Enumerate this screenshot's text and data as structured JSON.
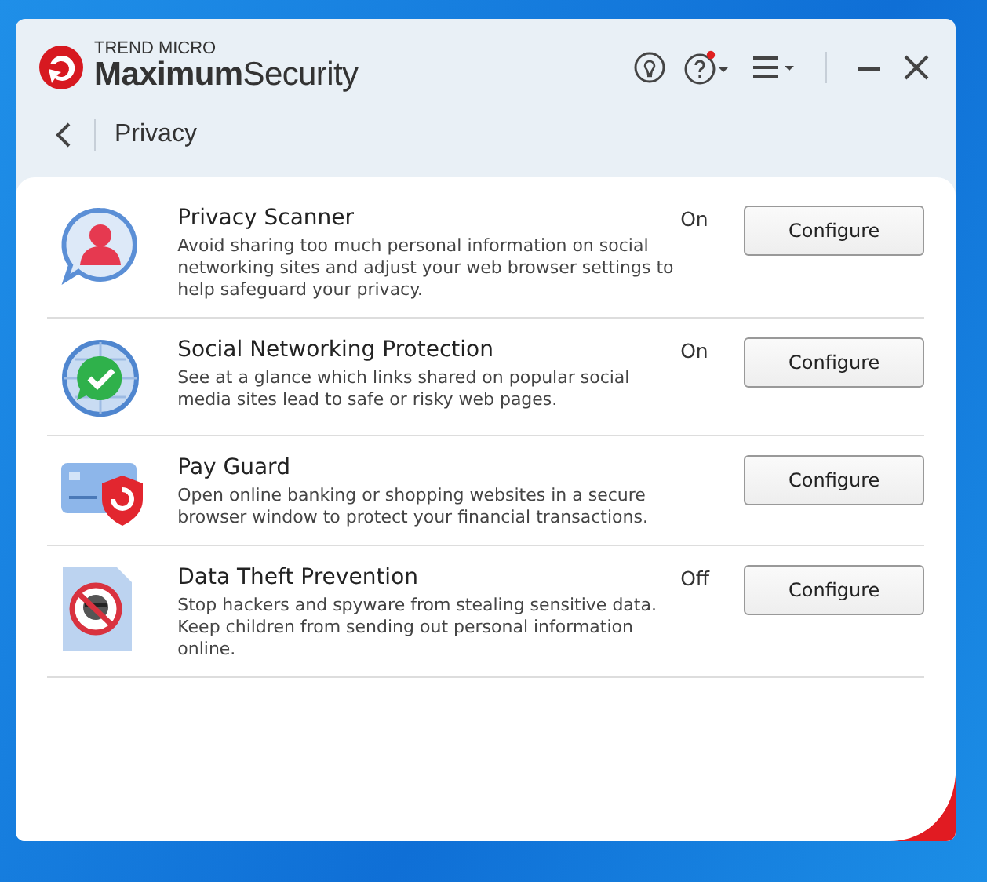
{
  "window": {
    "brand": "TREND MICRO",
    "product": "**Maximum**Security"
  },
  "nav": {
    "title": "Privacy"
  },
  "features": [
    {
      "kind": "privacy-scanner",
      "title": "Privacy Scanner",
      "status": "On",
      "description": "Avoid sharing too much personal information on social networking sites and adjust your web browser settings to help safeguard your privacy.",
      "button": "Configure"
    },
    {
      "kind": "social-networking",
      "title": "Social Networking Protection",
      "status": "On",
      "description": "See at a glance which links shared on popular social media sites lead to safe or risky web pages.",
      "button": "Configure"
    },
    {
      "kind": "pay-guard",
      "title": "Pay Guard",
      "description": "Open online banking or shopping websites in a secure browser window to protect your financial transactions.",
      "button": "Configure"
    },
    {
      "kind": "data-theft",
      "title": "Data Theft Prevention",
      "status": "Off",
      "description": "Stop hackers and spyware from stealing sensitive data. Keep children from sending out personal information online.",
      "button": "Configure"
    }
  ]
}
